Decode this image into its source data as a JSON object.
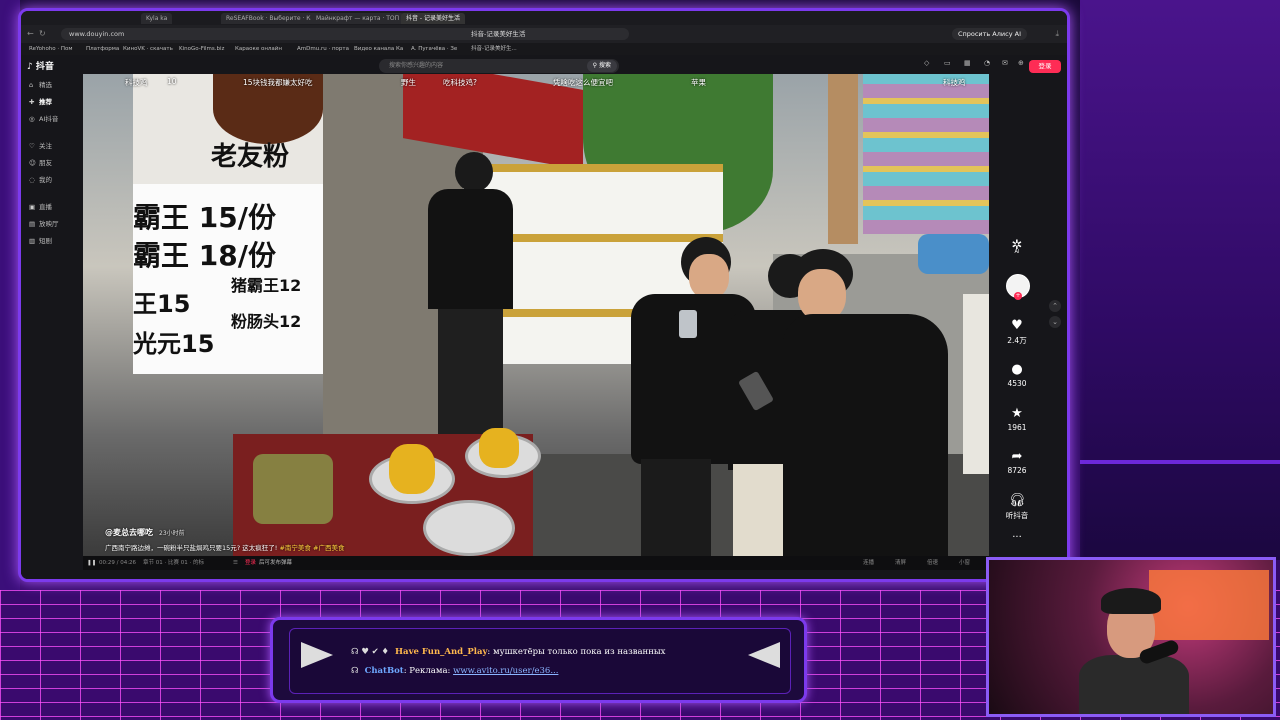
{
  "browser": {
    "tabs": [
      "Kyla ka",
      "ReSEAFBook · Выберите · Камера",
      "Майнкрафт — карта · ТОП",
      "抖音 - 记录美好生活"
    ],
    "url": "www.douyin.com",
    "page_title": "抖音-记录美好生活",
    "alice_button": "Спросить Алису AI",
    "bookmarks": [
      "ReYohoho · Пом",
      "Платформа",
      "КиноVK · скачать",
      "KinoGo-Films.biz",
      "Караоке онлайн",
      "AmDmu.ru · порта",
      "Видео канала Ка",
      "А. Пугачёва · Зе",
      "抖音-记录美好生..."
    ]
  },
  "douyin": {
    "logo": "抖音",
    "nav": [
      {
        "icon": "⌂",
        "label": "精选"
      },
      {
        "icon": "✚",
        "label": "推荐"
      },
      {
        "icon": "◎",
        "label": "AI抖音"
      },
      {
        "icon": "♡",
        "label": "关注"
      },
      {
        "icon": "☺",
        "label": "朋友"
      },
      {
        "icon": "◌",
        "label": "我的"
      },
      {
        "icon": "▣",
        "label": "直播"
      },
      {
        "icon": "▤",
        "label": "放映厅"
      },
      {
        "icon": "▥",
        "label": "短剧"
      }
    ],
    "search_placeholder": "搜索你感兴趣的内容",
    "search_button": "搜索",
    "top_icons": [
      "充钻石",
      "客户端",
      "壁纸",
      "通知",
      "私信",
      "投稿"
    ],
    "login_button": "登录",
    "topics": [
      "科技鸡",
      "10",
      "15块钱我都嫌太好吃",
      "野生",
      "吃科技鸡?",
      "凭啥吃这么便宜吧",
      "苹果",
      "科技鸡"
    ],
    "author": "@麦总去哪吃",
    "posted_time": "23小时前",
    "description": "广西南宁路边摊，一碗粉半只盐焗鸡只要15元? 这太疯狂了!",
    "hashtags": [
      "#南宁美食",
      "#广西美食"
    ],
    "sign_text": {
      "top": "老友粉",
      "line1": "霸王 15/份",
      "line2": "霸王 18/份",
      "line3_left": "王15",
      "line3_right": "猪霸王12",
      "line4_left": "光元15",
      "line4_right": "粉肠头12"
    },
    "controls": {
      "time": "00:29 / 04:26",
      "shortcut": "章节 01 · 比赛 01 · 的标",
      "danmaku_label": "登录",
      "danmaku_hint": "后可发布弹幕",
      "right": [
        "连播",
        "清屏",
        "倍速",
        "小窗"
      ]
    },
    "actions": {
      "ai_label": "AI",
      "likes": "2.4万",
      "comments": "4530",
      "favorites": "1961",
      "shares": "8726",
      "listen": "听抖音",
      "more": "···"
    }
  },
  "chat": {
    "messages": [
      {
        "user": "Have Fun_And_Play",
        "text": ": мушкетёры только пока из названных"
      },
      {
        "user": "ChatBot",
        "text": ": Реклама: ",
        "link": "www.avito.ru/user/e36..."
      }
    ]
  }
}
